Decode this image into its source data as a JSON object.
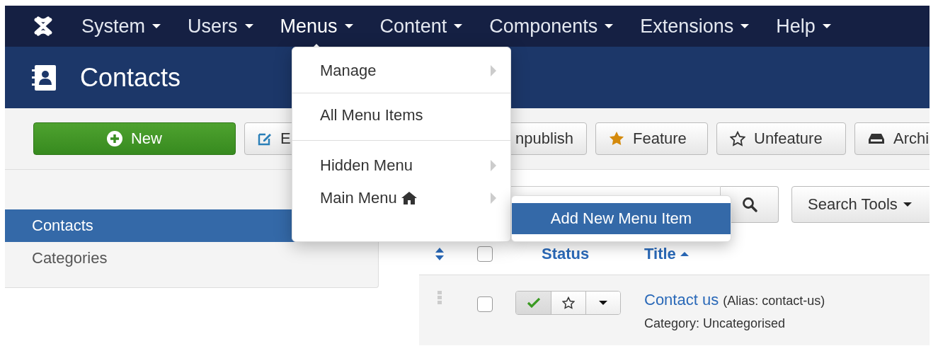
{
  "nav": {
    "items": [
      {
        "label": "System",
        "selected": false
      },
      {
        "label": "Users",
        "selected": false
      },
      {
        "label": "Menus",
        "selected": true
      },
      {
        "label": "Content",
        "selected": false
      },
      {
        "label": "Components",
        "selected": false
      },
      {
        "label": "Extensions",
        "selected": false
      },
      {
        "label": "Help",
        "selected": false
      }
    ]
  },
  "header": {
    "title": "Contacts"
  },
  "toolbar": {
    "buttons": [
      {
        "label": "New",
        "kind": "new"
      },
      {
        "label": "E",
        "kind": "edit"
      },
      {
        "label": "npublish",
        "kind": "unpublish"
      },
      {
        "label": "Feature",
        "kind": "feature"
      },
      {
        "label": "Unfeature",
        "kind": "unfeature"
      },
      {
        "label": "Archi",
        "kind": "archive"
      }
    ]
  },
  "sidebar": {
    "items": [
      {
        "label": "Contacts",
        "selected": true
      },
      {
        "label": "Categories",
        "selected": false
      }
    ]
  },
  "search_tools": {
    "label": "Search Tools"
  },
  "table": {
    "select_all": {
      "checked": false
    },
    "columns": [
      {
        "label": "Status",
        "sorted": false
      },
      {
        "label": "Title",
        "sorted": true
      }
    ],
    "rows": [
      {
        "checked": false,
        "published": true,
        "featured": false,
        "title": "Contact us",
        "alias": "(Alias: contact-us)",
        "category": "Category: Uncategorised"
      }
    ]
  },
  "menus_dropdown": {
    "groups": [
      [
        {
          "label": "Manage",
          "submenu": true,
          "home": false
        }
      ],
      [
        {
          "label": "All Menu Items",
          "submenu": false,
          "home": false
        }
      ],
      [
        {
          "label": "Hidden Menu",
          "submenu": true,
          "home": false
        },
        {
          "label": "Main Menu",
          "submenu": true,
          "home": true
        }
      ]
    ]
  },
  "submenu": {
    "items": [
      {
        "label": "Add New Menu Item",
        "selected": true
      }
    ]
  }
}
